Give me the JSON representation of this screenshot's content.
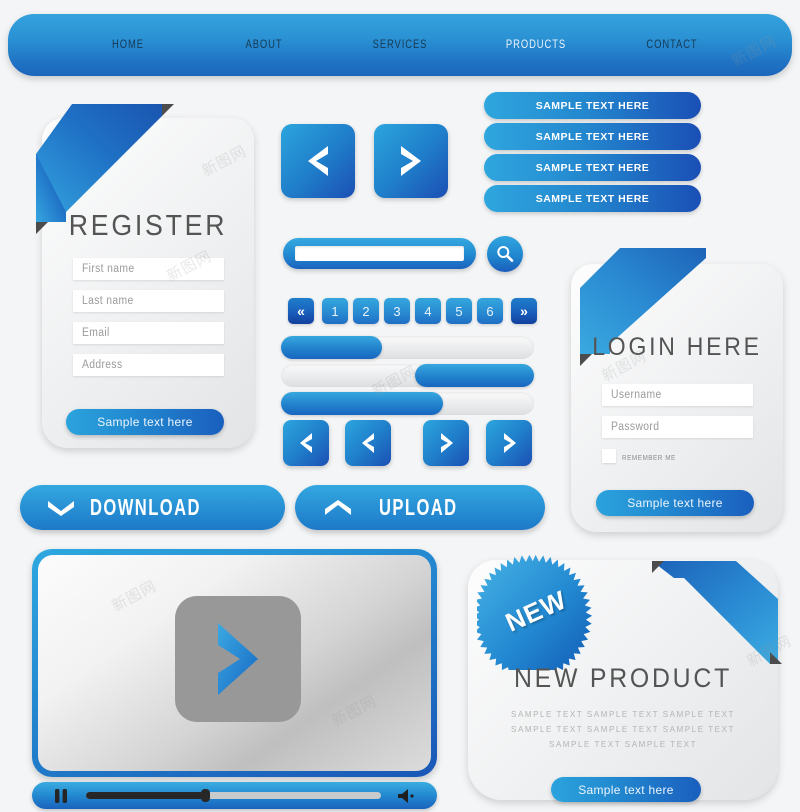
{
  "nav": {
    "items": [
      {
        "label": "HOME"
      },
      {
        "label": "ABOUT"
      },
      {
        "label": "SERVICES"
      },
      {
        "label": "PRODUCTS"
      },
      {
        "label": "CONTACT"
      }
    ]
  },
  "register_card": {
    "title": "REGISTER",
    "fields": [
      {
        "placeholder": "First name"
      },
      {
        "placeholder": "Last name"
      },
      {
        "placeholder": "Email"
      },
      {
        "placeholder": "Address"
      }
    ],
    "submit_label": "Sample text here"
  },
  "login_card": {
    "title": "LOGIN HERE",
    "fields": [
      {
        "placeholder": "Username"
      },
      {
        "placeholder": "Password"
      }
    ],
    "remember_label": "REMEMBER ME",
    "submit_label": "Sample text here"
  },
  "stack_buttons": [
    {
      "label": "SAMPLE TEXT HERE"
    },
    {
      "label": "SAMPLE TEXT HERE"
    },
    {
      "label": "SAMPLE TEXT HERE"
    },
    {
      "label": "SAMPLE TEXT HERE"
    }
  ],
  "carousel_arrows": [
    {
      "icon": "chevron-left-icon"
    },
    {
      "icon": "chevron-right-icon"
    }
  ],
  "search": {
    "value": "",
    "placeholder": "",
    "icon": "search-icon"
  },
  "pagination": {
    "prev_label": "«",
    "next_label": "»",
    "pages": [
      "1",
      "2",
      "3",
      "4",
      "5",
      "6"
    ],
    "current": "1"
  },
  "progress_bars": [
    {
      "percent": 40,
      "align": "left"
    },
    {
      "percent": 47,
      "align": "right"
    },
    {
      "percent": 64,
      "align": "left"
    }
  ],
  "nav_arrow_buttons": [
    {
      "icon": "chevron-left-icon"
    },
    {
      "icon": "chevron-left-icon"
    },
    {
      "icon": "chevron-right-icon"
    },
    {
      "icon": "chevron-right-icon"
    }
  ],
  "action_buttons": [
    {
      "label": "DOWNLOAD",
      "icon": "chevron-down-icon"
    },
    {
      "label": "UPLOAD",
      "icon": "chevron-up-icon"
    }
  ],
  "player": {
    "play_icon": "play-chevron-icon",
    "pause_icon": "pause-icon",
    "volume_icon": "volume-icon",
    "progress_percent": 40
  },
  "new_product_card": {
    "badge_label": "NEW",
    "title": "NEW PRODUCT",
    "body_lines": [
      "SAMPLE TEXT  SAMPLE TEXT  SAMPLE TEXT",
      "SAMPLE TEXT  SAMPLE TEXT  SAMPLE TEXT",
      "SAMPLE TEXT  SAMPLE TEXT"
    ],
    "submit_label": "Sample text here"
  },
  "watermarks": [
    "新图网",
    "新图网",
    "新图网",
    "新图网",
    "新图网",
    "新图网",
    "新图网",
    "新图网"
  ],
  "colors": {
    "blue_light": "#34a6de",
    "blue_mid": "#2288d0",
    "blue_dark": "#1a5fbb",
    "ribbon_dark": "#1d63b8",
    "card_bg": "#f0f1f2",
    "text_grey": "#545454"
  }
}
